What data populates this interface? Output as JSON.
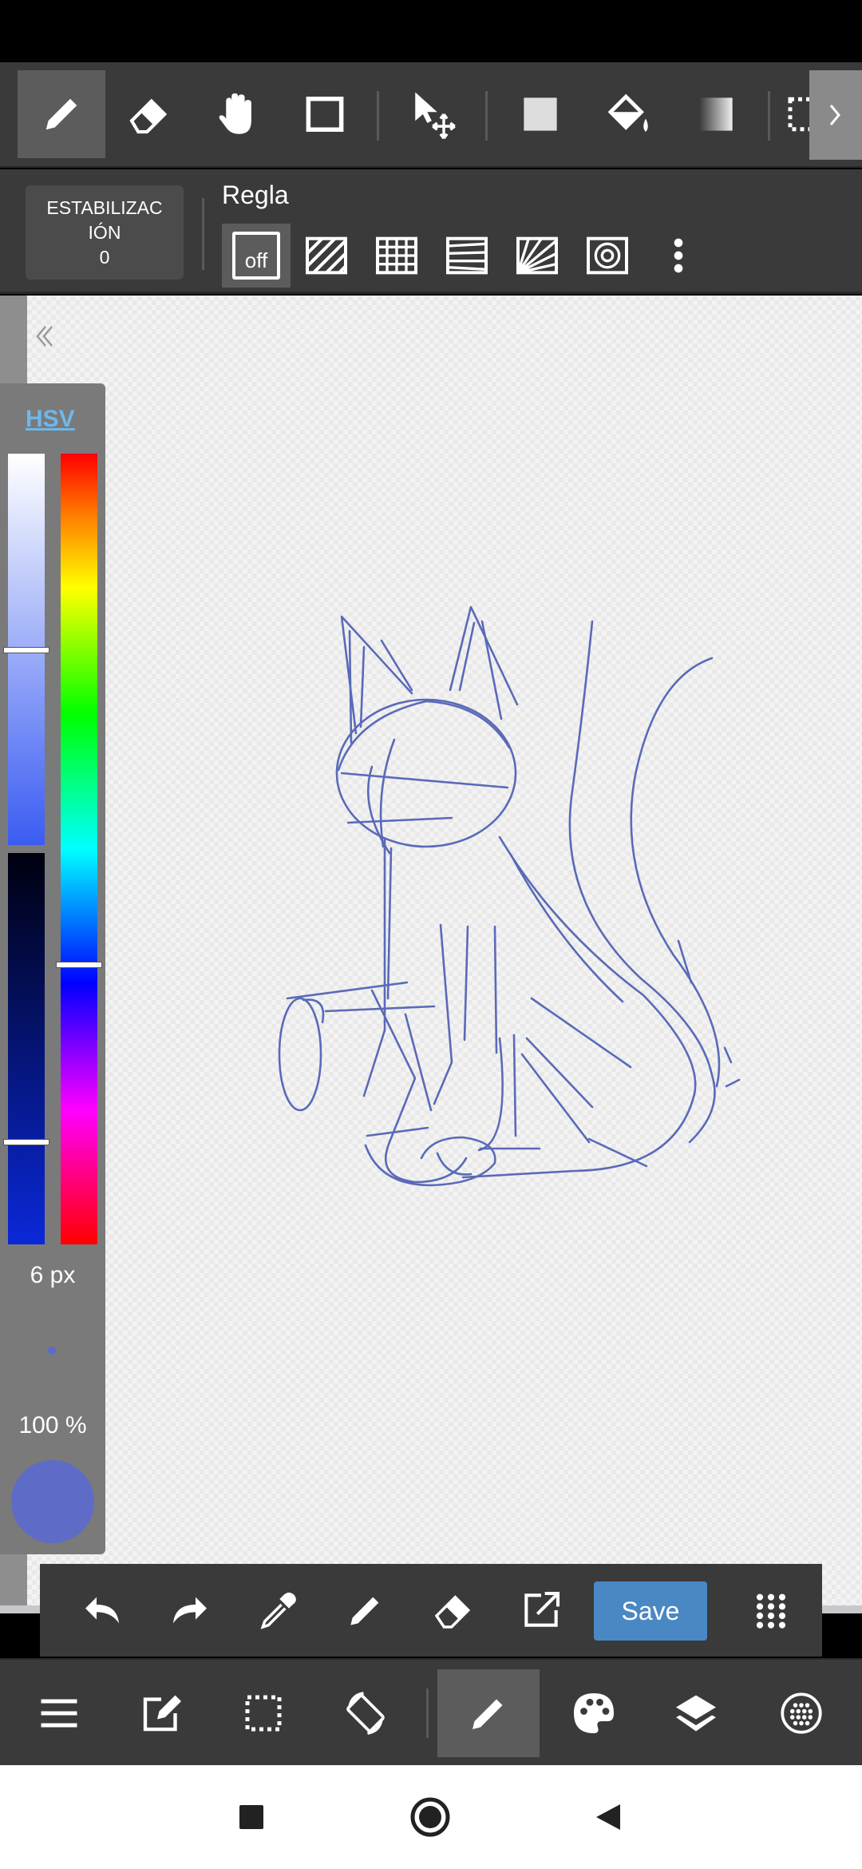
{
  "sub_toolbar": {
    "stabilization_line1": "ESTABILIZAC",
    "stabilization_line2": "IÓN",
    "stabilization_value": "0",
    "ruler_title": "Regla",
    "ruler_off_label": "off"
  },
  "color_panel": {
    "mode_label": "HSV",
    "brush_size": "6 px",
    "opacity": "100 %",
    "current_color": "#5e6cc8"
  },
  "quick_bar": {
    "save_label": "Save"
  },
  "icons": {
    "top_toolbar": [
      "pen-icon",
      "eraser-icon",
      "hand-icon",
      "rectangle-icon",
      "move-icon",
      "fill-rect-icon",
      "bucket-icon",
      "gradient-icon",
      "selection-icon"
    ],
    "quick_bar": [
      "undo-icon",
      "redo-icon",
      "eyedropper-icon",
      "pen-icon",
      "eraser-icon",
      "export-icon",
      "grid-icon"
    ],
    "bottom_toolbar": [
      "menu-icon",
      "edit-icon",
      "selection-icon",
      "rotate-icon",
      "brush-icon",
      "palette-icon",
      "layers-icon",
      "material-icon"
    ],
    "nav": [
      "recents-icon",
      "home-icon",
      "back-icon"
    ]
  },
  "colors": {
    "toolbar": "#3a3a3a",
    "stroke": "#5a6ab8",
    "save_button": "#4a88c4"
  }
}
